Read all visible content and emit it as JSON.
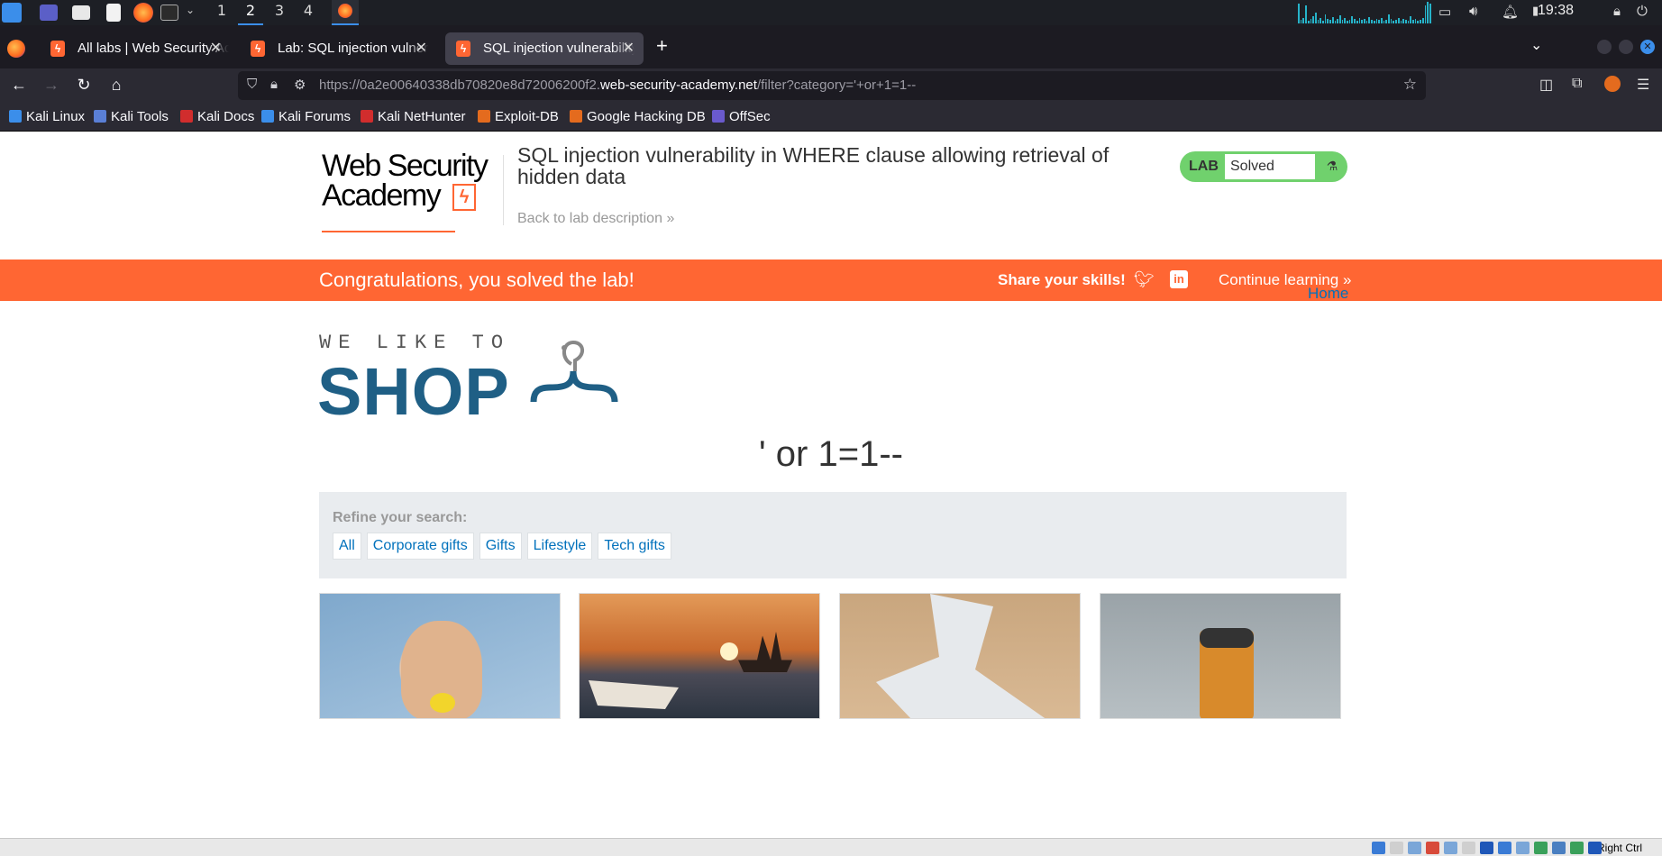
{
  "taskbar": {
    "workspaces": [
      "1",
      "2",
      "3",
      "4"
    ],
    "active_workspace": "2",
    "clock": "19:38"
  },
  "tabs": [
    {
      "label": "All labs | Web Security Academy",
      "active": false
    },
    {
      "label": "Lab: SQL injection vulnerability",
      "active": false
    },
    {
      "label": "SQL injection vulnerability",
      "active": true
    }
  ],
  "navbar": {
    "url_prefix": "https://0a2e00640338db70820e8d72006200f2.",
    "url_domain": "web-security-academy.net",
    "url_suffix": "/filter?category='+or+1=1--"
  },
  "bookmarks": [
    {
      "label": "Kali Linux",
      "color": "#3b8eea"
    },
    {
      "label": "Kali Tools",
      "color": "#5a7fd6"
    },
    {
      "label": "Kali Docs",
      "color": "#d12d2d"
    },
    {
      "label": "Kali Forums",
      "color": "#3b8eea"
    },
    {
      "label": "Kali NetHunter",
      "color": "#d12d2d"
    },
    {
      "label": "Exploit-DB",
      "color": "#e46b1e"
    },
    {
      "label": "Google Hacking DB",
      "color": "#e46b1e"
    },
    {
      "label": "OffSec",
      "color": "#6a5acd"
    }
  ],
  "header": {
    "logo_line1": "Web Security",
    "logo_line2": "Academy",
    "lab_title": "SQL injection vulnerability in WHERE clause allowing retrieval of hidden data",
    "back_link": "Back to lab description",
    "badge_label": "LAB",
    "badge_status": "Solved"
  },
  "banner": {
    "message": "Congratulations, you solved the lab!",
    "share": "Share your skills!",
    "continue": "Continue learning"
  },
  "page": {
    "home_link": "Home",
    "shop_logo_top": "WE LIKE TO",
    "shop_logo_main": "SHOP",
    "query_heading": "' or 1=1--",
    "refine_label": "Refine your search:",
    "filters": [
      "All",
      "Corporate gifts",
      "Gifts",
      "Lifestyle",
      "Tech gifts"
    ]
  },
  "statusbar": {
    "host_key": "Right Ctrl"
  },
  "colors": {
    "accent": "#ff6633",
    "link": "#0071bc",
    "solved": "#70d16d"
  }
}
